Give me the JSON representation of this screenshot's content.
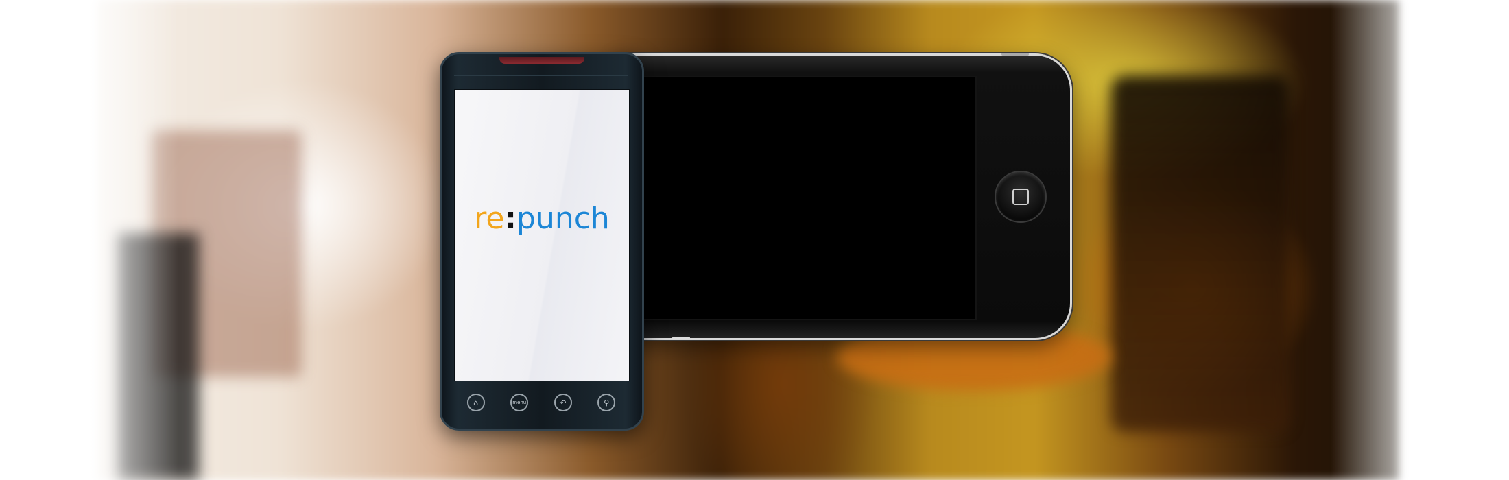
{
  "scene": {
    "background_colors": {
      "warm_yellow": "#c49620",
      "orange": "#d26e0a",
      "dark_brown": "#2a1606",
      "white": "#ffffff"
    }
  },
  "android_phone": {
    "logo": {
      "part1": "re",
      "separator": ":",
      "part2": "punch",
      "colors": {
        "part1": "#f2a51c",
        "separator": "#111111",
        "part2": "#1c86d6"
      }
    },
    "nav_buttons": {
      "home_icon": "⌂",
      "menu_label": "menu",
      "back_icon": "↶",
      "search_icon": "⚲"
    }
  },
  "iphone": {
    "screen_color": "#000000"
  }
}
